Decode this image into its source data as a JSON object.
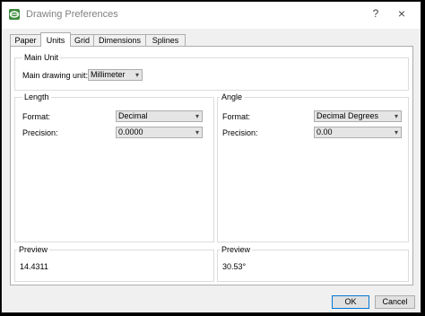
{
  "window": {
    "title": "Drawing Preferences"
  },
  "titlebar": {
    "help": "?",
    "close": "×"
  },
  "tabs": [
    {
      "label": "Paper"
    },
    {
      "label": "Units"
    },
    {
      "label": "Grid"
    },
    {
      "label": "Dimensions"
    },
    {
      "label": "Splines"
    }
  ],
  "active_tab": "Units",
  "main_unit": {
    "group_label": "Main Unit",
    "field_label": "Main drawing unit:",
    "value": "Millimeter"
  },
  "length": {
    "group_label": "Length",
    "format_label": "Format:",
    "format_value": "Decimal",
    "precision_label": "Precision:",
    "precision_value": "0.0000"
  },
  "angle": {
    "group_label": "Angle",
    "format_label": "Format:",
    "format_value": "Decimal Degrees",
    "precision_label": "Precision:",
    "precision_value": "0.00"
  },
  "preview_length": {
    "group_label": "Preview",
    "value": "14.4311"
  },
  "preview_angle": {
    "group_label": "Preview",
    "value": "30.53°"
  },
  "buttons": {
    "ok": "OK",
    "cancel": "Cancel"
  },
  "colors": {
    "focus_border": "#0078d7",
    "app_icon_green": "#3a8a3a"
  }
}
